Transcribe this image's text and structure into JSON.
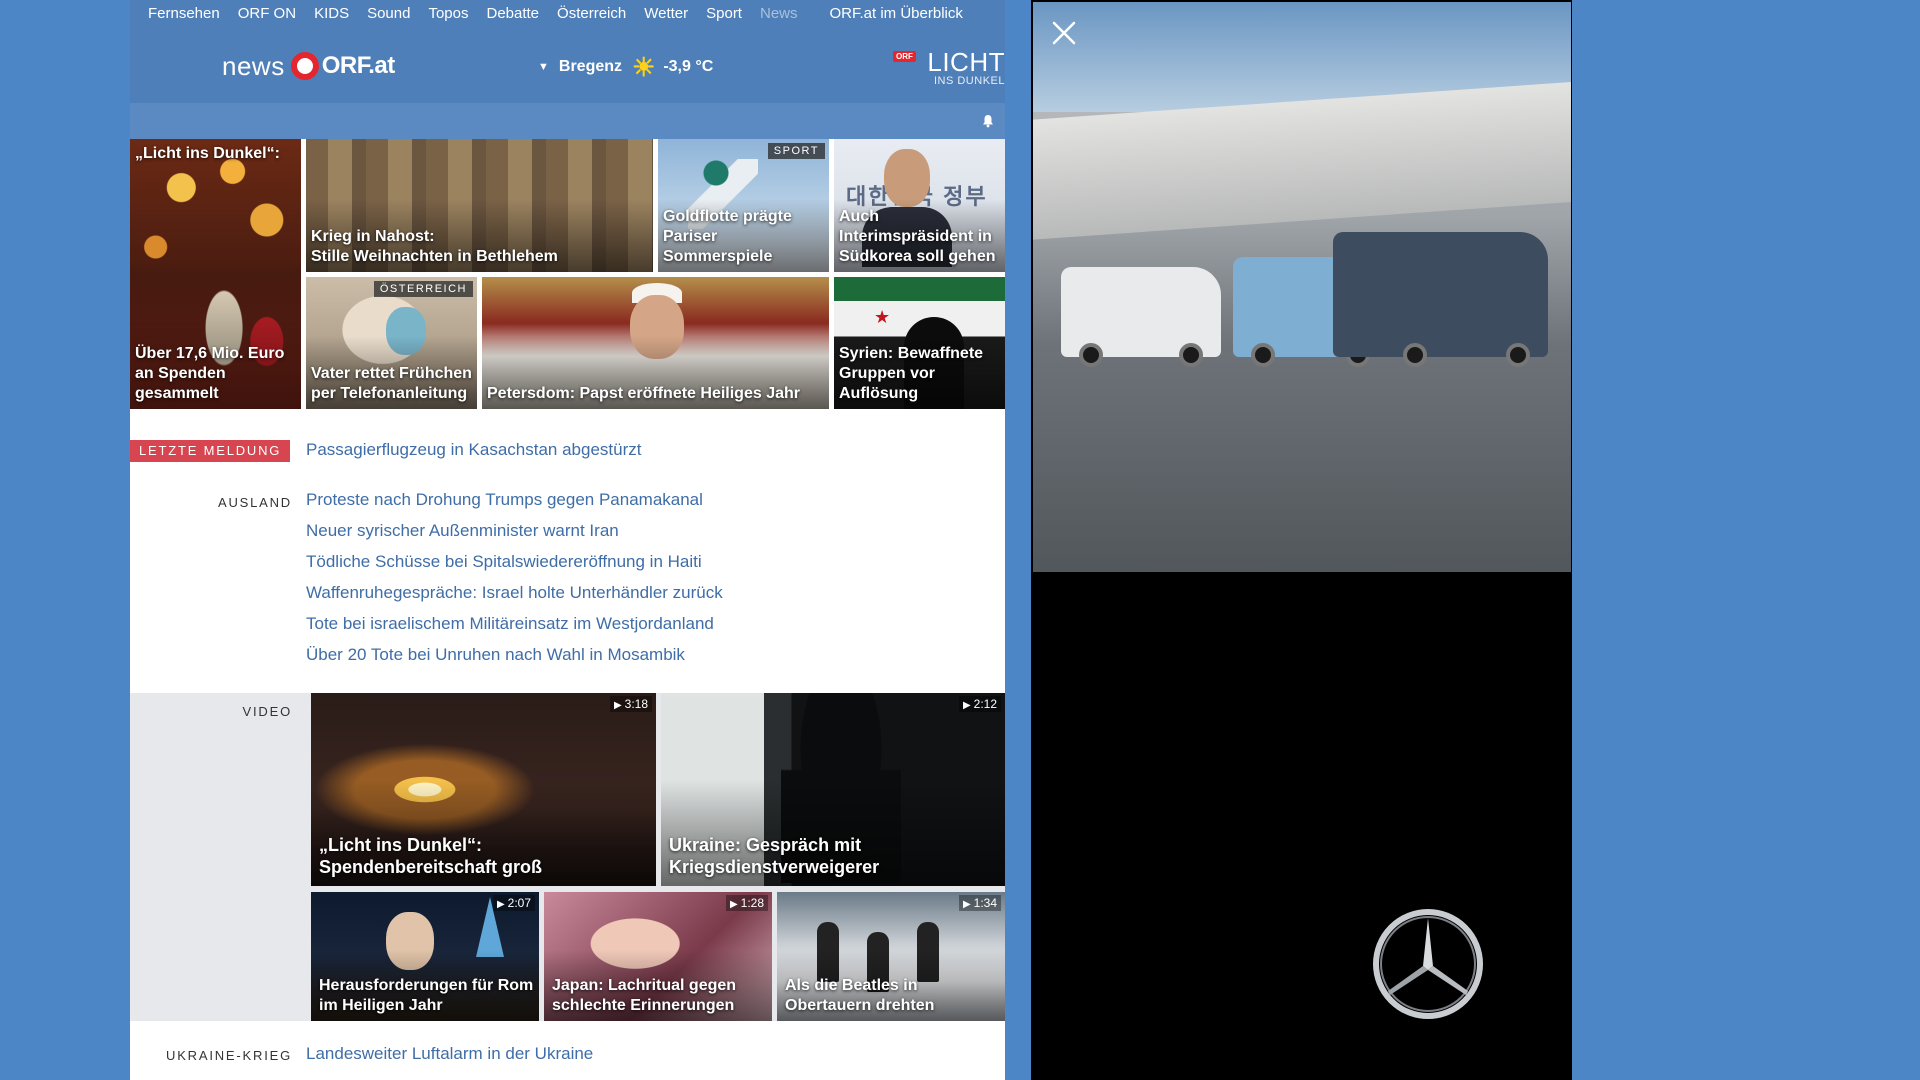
{
  "nav": {
    "items": [
      {
        "label": "Fernsehen"
      },
      {
        "label": "ORF ON"
      },
      {
        "label": "KIDS"
      },
      {
        "label": "Sound"
      },
      {
        "label": "Topos"
      },
      {
        "label": "Debatte"
      },
      {
        "label": "Österreich"
      },
      {
        "label": "Wetter"
      },
      {
        "label": "Sport"
      },
      {
        "label": "News"
      }
    ],
    "overview": "ORF.at im Überblick"
  },
  "header": {
    "logo_news": "news",
    "logo_orf": "ORF.at",
    "weather": {
      "city": "Bregenz",
      "caret": "▼",
      "sun": "☀",
      "temperature": "-3,9 °C"
    },
    "lid": {
      "orf": "ORF",
      "licht": "LICHT",
      "ins": "INS DUNKEL"
    }
  },
  "tiles": {
    "licht": {
      "top": "„Licht ins Dunkel“:",
      "caption": "Über 17,6 Mio. Euro an Spenden gesammelt"
    },
    "bethlehem": {
      "caption_line1": "Krieg in Nahost:",
      "caption_line2": "Stille Weihnachten in Bethlehem"
    },
    "sport": {
      "category": "SPORT",
      "caption": "Goldflotte prägte Pariser Sommerspiele"
    },
    "korea": {
      "hangul": "대한민국 정부",
      "caption": "Auch Interimspräsident in Südkorea soll gehen"
    },
    "baby": {
      "category": "ÖSTERREICH",
      "caption": "Vater rettet Frühchen per Telefonanleitung"
    },
    "pope": {
      "caption": "Petersdom: Papst eröffnete Heiliges Jahr"
    },
    "syria": {
      "caption": "Syrien: Bewaffnete Gruppen vor Auflösung"
    }
  },
  "breaking": {
    "badge": "LETZTE MELDUNG",
    "headline": "Passagierflugzeug in Kasachstan abgestürzt"
  },
  "ausland": {
    "label": "AUSLAND",
    "items": [
      "Proteste nach Drohung Trumps gegen Panamakanal",
      "Neuer syrischer Außenminister warnt Iran",
      "Tödliche Schüsse bei Spitalswiedereröffnung in Haiti",
      "Waffenruhegespräche: Israel holte Unterhändler zurück",
      "Tote bei israelischem Militäreinsatz im Westjordanland",
      "Über 20 Tote bei Unruhen nach Wahl in Mosambik"
    ]
  },
  "video": {
    "label": "VIDEO",
    "play": "▶",
    "items": [
      {
        "duration": "3:18",
        "caption": "„Licht ins Dunkel“: Spendenbereitschaft groß"
      },
      {
        "duration": "2:12",
        "caption": "Ukraine: Gespräch mit Kriegsdienstverweigerer"
      },
      {
        "duration": "2:07",
        "caption": "Herausforderungen für Rom im Heiligen Jahr"
      },
      {
        "duration": "1:28",
        "caption": "Japan: Lachritual gegen schlechte Erinnerungen"
      },
      {
        "duration": "1:34",
        "caption": "Als die Beatles in Obertauern drehten"
      }
    ]
  },
  "ukraine": {
    "label": "UKRAINE-KRIEG",
    "headline": "Landesweiter Luftalarm in der Ukraine"
  },
  "ad": {
    "close_icon": "close-icon",
    "brand_logo": "mercedes-star-logo"
  },
  "colors": {
    "background": "#4d86c7",
    "header": "#4f7fb8",
    "link": "#3f6da7",
    "breaking": "#d64550",
    "orf_red": "#e4262e"
  }
}
